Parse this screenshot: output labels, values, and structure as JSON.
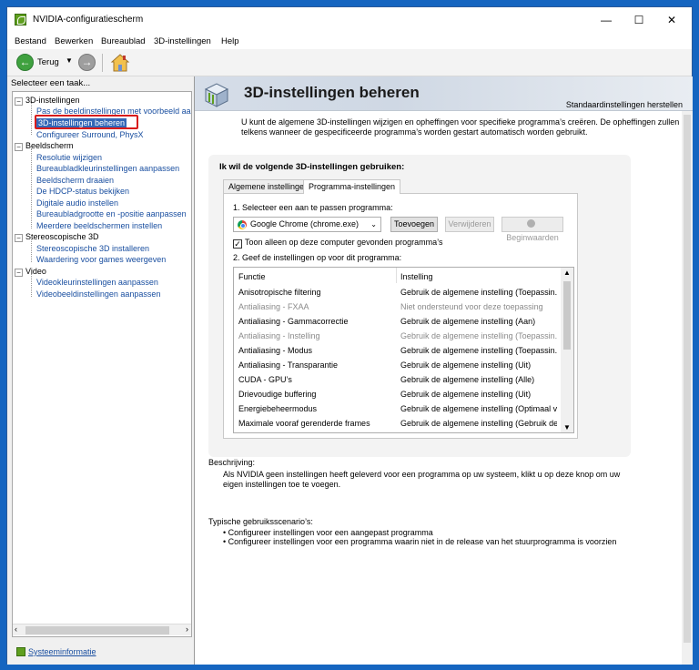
{
  "window": {
    "title": "NVIDIA-configuratiescherm"
  },
  "menu": [
    "Bestand",
    "Bewerken",
    "Bureaublad",
    "3D-instellingen",
    "Help"
  ],
  "toolbar": {
    "back_label": "Terug",
    "back_icon": "back-arrow-icon",
    "forward_icon": "forward-arrow-icon",
    "home_icon": "home-icon"
  },
  "sidebar": {
    "task_header": "Selecteer een taak...",
    "categories": [
      {
        "label": "3D-instellingen",
        "items": [
          "Pas de beeldinstellingen met voorbeeld aan",
          "3D-instellingen beheren",
          "Configureer Surround, PhysX"
        ]
      },
      {
        "label": "Beeldscherm",
        "items": [
          "Resolutie wijzigen",
          "Bureaubladkleurinstellingen aanpassen",
          "Beeldscherm draaien",
          "De HDCP-status bekijken",
          "Digitale audio instellen",
          "Bureaubladgrootte en -positie aanpassen",
          "Meerdere beeldschermen instellen"
        ]
      },
      {
        "label": "Stereoscopische 3D",
        "items": [
          "Stereoscopische 3D installeren",
          "Waardering voor games weergeven"
        ]
      },
      {
        "label": "Video",
        "items": [
          "Videokleurinstellingen aanpassen",
          "Videobeeldinstellingen aanpassen"
        ]
      }
    ],
    "selected_item": "3D-instellingen beheren",
    "sysinfo_label": "Systeeminformatie",
    "highlight_color": "#d81b1b",
    "selection_color": "#3367b7"
  },
  "main": {
    "title": "3D-instellingen beheren",
    "restore_link": "Standaardinstellingen herstellen",
    "intro": "U kunt de algemene 3D-instellingen wijzigen en opheffingen voor specifieke programma’s creëren. De opheffingen zullen telkens wanneer de gespecificeerde programma’s worden gestart automatisch worden gebruikt.",
    "group_title": "Ik wil de volgende 3D-instellingen gebruiken:",
    "tabs": [
      "Algemene instellingen",
      "Programma-instellingen"
    ],
    "active_tab": "Programma-instellingen",
    "step1": "1. Selecteer een aan te passen programma:",
    "program_selected": "Google Chrome (chrome.exe)",
    "buttons": {
      "add": "Toevoegen",
      "remove": "Verwijderen",
      "defaults": "Beginwaarden"
    },
    "checkbox_label": "Toon alleen op deze computer gevonden programma’s",
    "checkbox_checked": true,
    "step2": "2. Geef de instellingen op voor dit programma:",
    "table": {
      "headers": [
        "Functie",
        "Instelling"
      ],
      "rows": [
        {
          "function": "Anisotropische filtering",
          "setting": "Gebruik de algemene instelling (Toepassin...",
          "dim": false
        },
        {
          "function": "Antialiasing - FXAA",
          "setting": "Niet ondersteund voor deze toepassing",
          "dim": true
        },
        {
          "function": "Antialiasing - Gammacorrectie",
          "setting": "Gebruik de algemene instelling (Aan)",
          "dim": false
        },
        {
          "function": "Antialiasing - Instelling",
          "setting": "Gebruik de algemene instelling (Toepassin...",
          "dim": true
        },
        {
          "function": "Antialiasing - Modus",
          "setting": "Gebruik de algemene instelling (Toepassin...",
          "dim": false
        },
        {
          "function": "Antialiasing - Transparantie",
          "setting": "Gebruik de algemene instelling (Uit)",
          "dim": false
        },
        {
          "function": "CUDA - GPU’s",
          "setting": "Gebruik de algemene instelling (Alle)",
          "dim": false
        },
        {
          "function": "Drievoudige buffering",
          "setting": "Gebruik de algemene instelling (Uit)",
          "dim": false
        },
        {
          "function": "Energiebeheermodus",
          "setting": "Gebruik de algemene instelling (Optimaal v...",
          "dim": false
        },
        {
          "function": "Maximale vooraf gerenderde frames",
          "setting": "Gebruik de algemene instelling (Gebruik de...",
          "dim": false
        }
      ]
    },
    "description_title": "Beschrijving:",
    "description_text": "Als NVIDIA geen instellingen heeft geleverd voor een programma op uw systeem, klikt u op deze knop om uw eigen instellingen toe te voegen.",
    "scenarios_title": "Typische gebruiksscenario’s:",
    "scenarios": [
      "Configureer instellingen voor een aangepast programma",
      "Configureer instellingen voor een programma waarin niet in de release van het stuurprogramma is voorzien"
    ]
  }
}
